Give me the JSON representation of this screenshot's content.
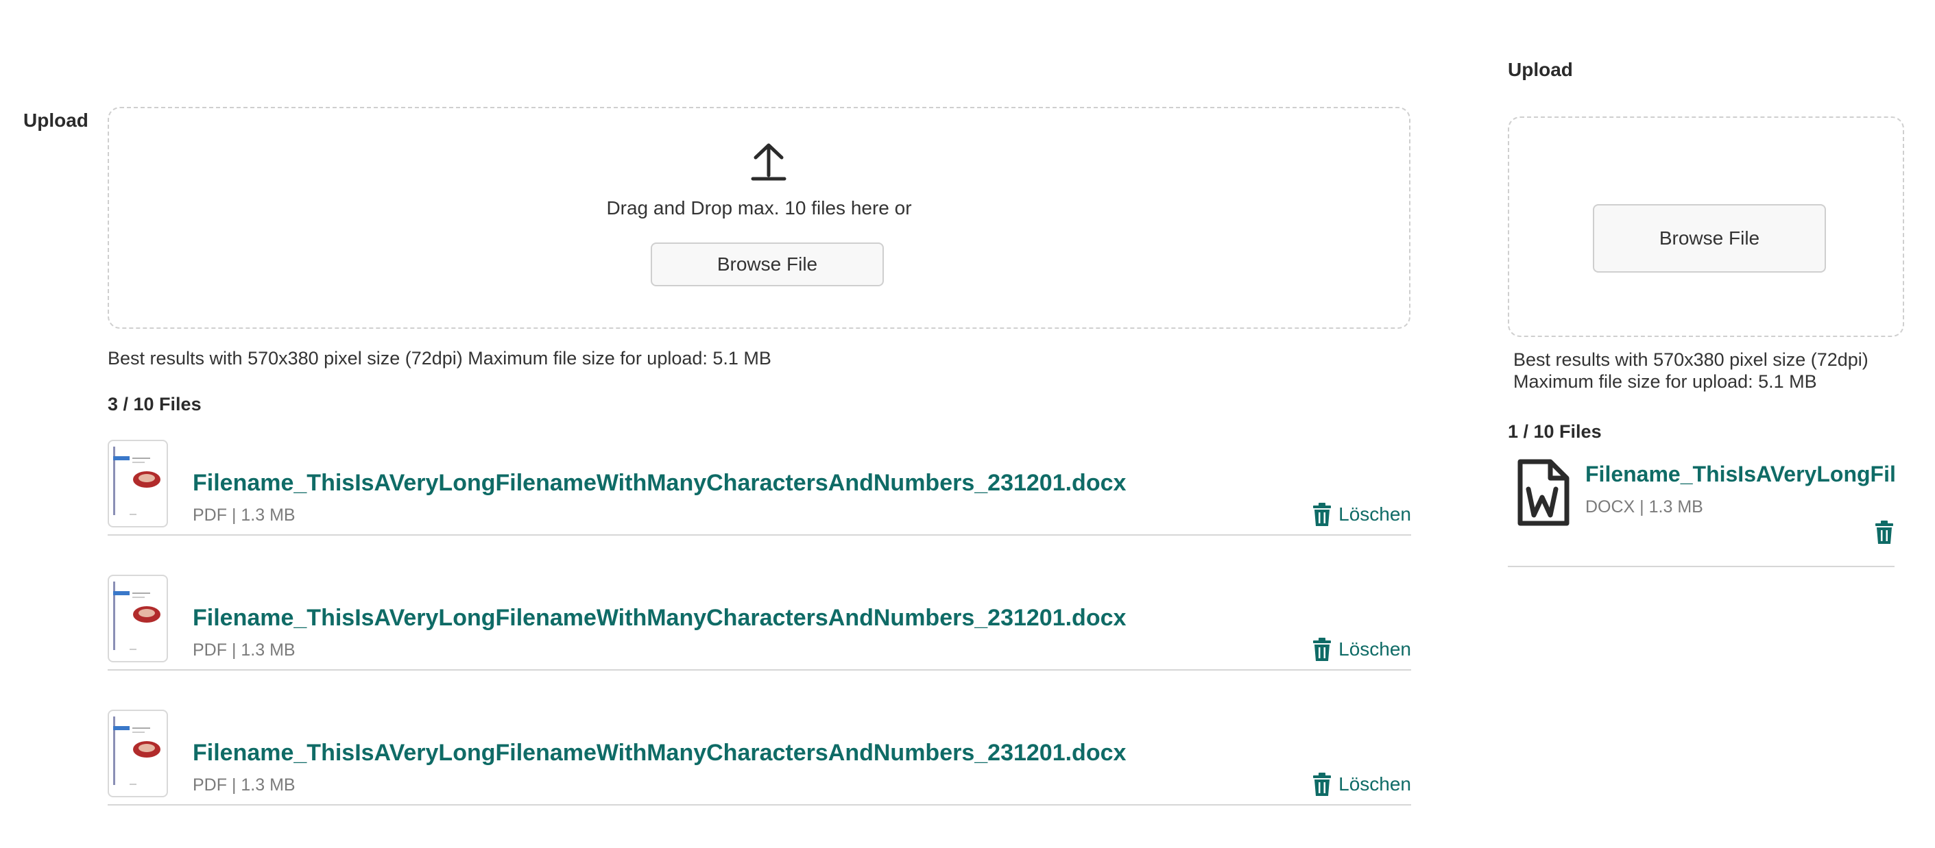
{
  "left": {
    "label": "Upload",
    "dropzone_text": "Drag and Drop max. 10 files here or",
    "browse_label": "Browse File",
    "hint": "Best results with 570x380 pixel size (72dpi) Maximum file size for upload: 5.1 MB",
    "files_count": "3 / 10 Files",
    "files": [
      {
        "name": "Filename_ThisIsAVeryLongFilenameWithManyCharactersAndNumbers_231201.docx",
        "meta": "PDF | 1.3 MB",
        "delete_label": "Löschen"
      },
      {
        "name": "Filename_ThisIsAVeryLongFilenameWithManyCharactersAndNumbers_231201.docx",
        "meta": "PDF | 1.3 MB",
        "delete_label": "Löschen"
      },
      {
        "name": "Filename_ThisIsAVeryLongFilenameWithManyCharactersAndNumbers_231201.docx",
        "meta": "PDF | 1.3 MB",
        "delete_label": "Löschen"
      }
    ]
  },
  "right": {
    "label": "Upload",
    "browse_label": "Browse File",
    "hint_line1": "Best results with 570x380 pixel size (72dpi)",
    "hint_line2": "Maximum file size for upload: 5.1 MB",
    "files_count": "1 / 10 Files",
    "file": {
      "name": "Filename_ThisIsAVeryLongFil",
      "meta": "DOCX | 1.3 MB"
    }
  },
  "colors": {
    "accent": "#0f6b66",
    "border": "#cfcfcf",
    "text": "#333333",
    "muted": "#7b7b7b"
  },
  "icons": {
    "upload": "upload-arrow-icon",
    "delete": "trash-icon",
    "word": "word-document-icon"
  }
}
